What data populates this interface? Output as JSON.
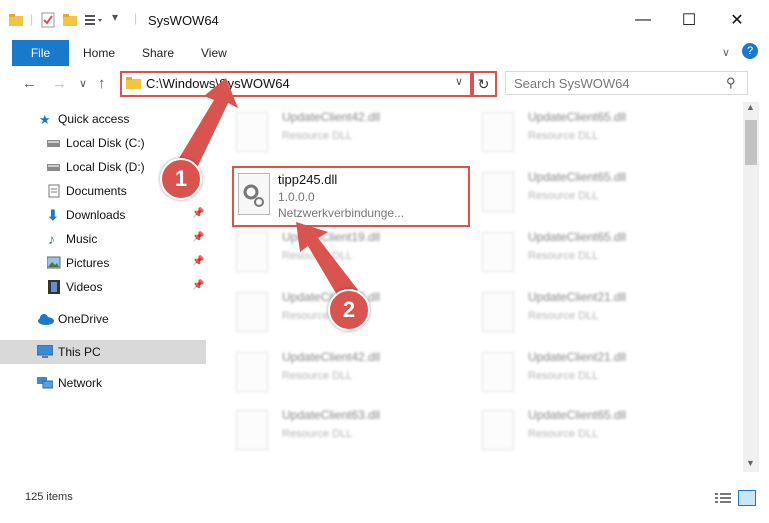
{
  "window": {
    "title": "SysWOW64",
    "minimize": "—",
    "maximize": "☐",
    "close": "✕"
  },
  "ribbon": {
    "file": "File",
    "home": "Home",
    "share": "Share",
    "view": "View"
  },
  "address": {
    "path": "C:\\Windows\\SysWOW64",
    "search_placeholder": "Search SysWOW64"
  },
  "sidebar": {
    "items": [
      {
        "label": "Quick access",
        "icon": "star-icon"
      },
      {
        "label": "Local Disk (C:)",
        "icon": "drive-icon"
      },
      {
        "label": "Local Disk (D:)",
        "icon": "drive-icon"
      },
      {
        "label": "Documents",
        "icon": "documents-icon"
      },
      {
        "label": "Downloads",
        "icon": "download-arrow-icon"
      },
      {
        "label": "Music",
        "icon": "music-note-icon"
      },
      {
        "label": "Pictures",
        "icon": "pictures-icon"
      },
      {
        "label": "Videos",
        "icon": "film-icon"
      },
      {
        "label": "OneDrive",
        "icon": "cloud-icon"
      },
      {
        "label": "This PC",
        "icon": "monitor-icon"
      },
      {
        "label": "Network",
        "icon": "network-icon"
      }
    ]
  },
  "files": {
    "highlighted": {
      "name": "tipp245.dll",
      "version": "1.0.0.0",
      "description": "Netzwerkverbindunge..."
    },
    "background": [
      {
        "name": "UpdateClient42.dll",
        "desc": "Resource DLL"
      },
      {
        "name": "UpdateClient65.dll",
        "desc": "Resource DLL"
      },
      {
        "name": "UpdateClient65.dll",
        "desc": "Resource DLL"
      },
      {
        "name": "UpdateClient19.dll",
        "desc": "Resource DLL"
      },
      {
        "name": "UpdateClient65.dll",
        "desc": "Resource DLL"
      },
      {
        "name": "UpdateClient56.dll",
        "desc": "Resource DLL"
      },
      {
        "name": "UpdateClient21.dll",
        "desc": "Resource DLL"
      },
      {
        "name": "UpdateClient42.dll",
        "desc": "Resource DLL"
      },
      {
        "name": "UpdateClient21.dll",
        "desc": "Resource DLL"
      },
      {
        "name": "UpdateClient63.dll",
        "desc": "Resource DLL"
      },
      {
        "name": "UpdateClient65.dll",
        "desc": "Resource DLL"
      }
    ]
  },
  "status": {
    "count": "125 items"
  },
  "annotations": {
    "step1": "1",
    "step2": "2"
  },
  "colors": {
    "accent": "#1979ca",
    "highlight": "#d9534f"
  }
}
